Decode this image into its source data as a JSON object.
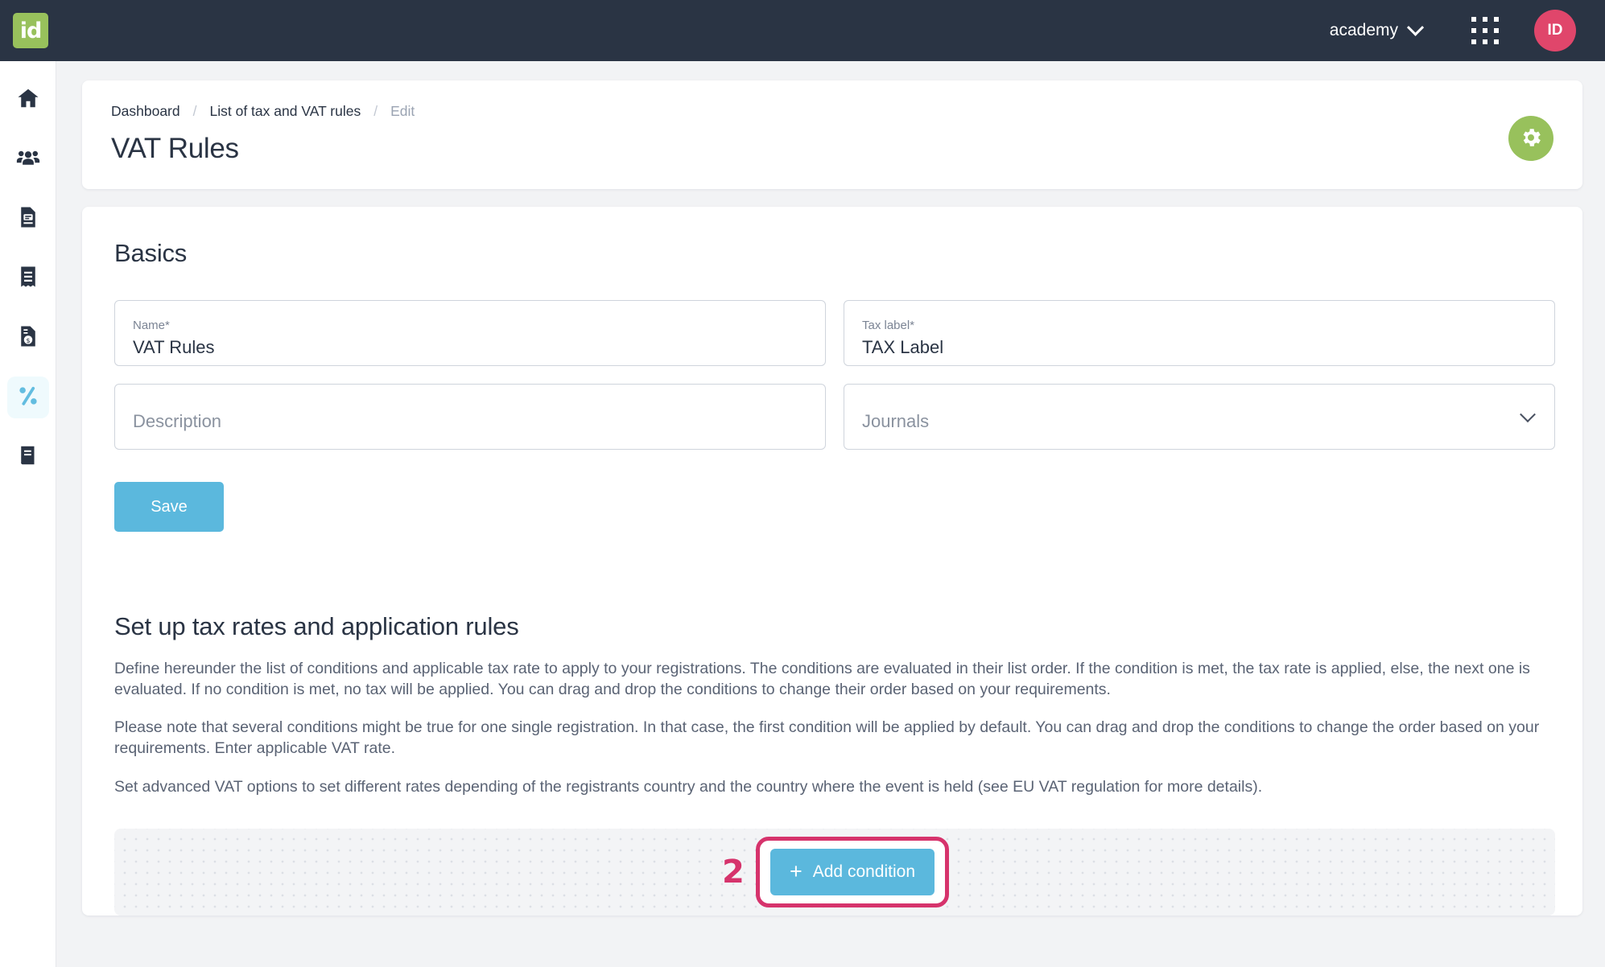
{
  "topbar": {
    "logo_text": "id",
    "org_name": "academy",
    "avatar_initials": "ID"
  },
  "sidebar": {
    "items": [
      {
        "icon": "home-icon",
        "name": "dashboard",
        "active": false
      },
      {
        "icon": "users-icon",
        "name": "contacts",
        "active": false
      },
      {
        "icon": "file-invoice-icon",
        "name": "documents",
        "active": false
      },
      {
        "icon": "receipt-icon",
        "name": "invoices",
        "active": false
      },
      {
        "icon": "file-dollar-icon",
        "name": "billing",
        "active": false
      },
      {
        "icon": "percent-icon",
        "name": "tax-rules",
        "active": true
      },
      {
        "icon": "book-icon",
        "name": "ledger",
        "active": false
      }
    ]
  },
  "header": {
    "breadcrumb": {
      "dashboard": "Dashboard",
      "list": "List of tax and VAT rules",
      "current": "Edit",
      "separator": "/"
    },
    "title": "VAT Rules"
  },
  "basics": {
    "title": "Basics",
    "name_field": {
      "label": "Name*",
      "value": "VAT Rules"
    },
    "tax_label_field": {
      "label": "Tax label*",
      "value": "TAX Label"
    },
    "description_field": {
      "placeholder": "Description",
      "value": ""
    },
    "journals_field": {
      "placeholder": "Journals",
      "value": ""
    },
    "save_label": "Save"
  },
  "rules": {
    "title": "Set up tax rates and application rules",
    "paragraph_1": "Define hereunder the list of conditions and applicable tax rate to apply to your registrations. The conditions are evaluated in their list order. If the condition is met, the tax rate is applied, else, the next one is evaluated. If no condition is met, no tax will be applied. You can drag and drop the conditions to change their order based on your requirements.",
    "paragraph_2": "Please note that several conditions might be true for one single registration. In that case, the first condition will be applied by default. You can drag and drop the conditions to change the order based on your requirements. Enter applicable VAT rate.",
    "paragraph_3": "Set advanced VAT options to set different rates depending of the registrants country and the country where the event is held (see EU VAT regulation for more details).",
    "annotation_number": "2",
    "add_condition_label": "Add condition",
    "add_condition_plus": "+"
  },
  "colors": {
    "header_bg": "#2a3444",
    "logo_green": "#98c15c",
    "accent_blue": "#5bb8dd",
    "avatar_pink": "#e0466b",
    "annotation_pink": "#d6336c",
    "page_bg": "#f2f3f5"
  }
}
